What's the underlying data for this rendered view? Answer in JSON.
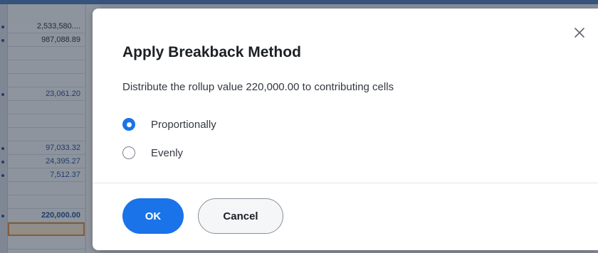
{
  "spreadsheet": {
    "values": [
      {
        "text": "2,533,580....",
        "style": ""
      },
      {
        "text": "987,088.89",
        "style": ""
      },
      {
        "text": "",
        "style": ""
      },
      {
        "text": "",
        "style": ""
      },
      {
        "text": "",
        "style": ""
      },
      {
        "text": "23,061.20",
        "style": "blue"
      },
      {
        "text": "",
        "style": ""
      },
      {
        "text": "",
        "style": ""
      },
      {
        "text": "",
        "style": ""
      },
      {
        "text": "97,033.32",
        "style": "blue"
      },
      {
        "text": "24,395.27",
        "style": "blue"
      },
      {
        "text": "7,512.37",
        "style": "blue"
      },
      {
        "text": "",
        "style": ""
      },
      {
        "text": "",
        "style": ""
      },
      {
        "text": "220,000.00",
        "style": "bold"
      },
      {
        "text": "",
        "style": "selected"
      },
      {
        "text": "",
        "style": ""
      }
    ]
  },
  "dialog": {
    "title": "Apply Breakback Method",
    "description": "Distribute the rollup value 220,000.00 to contributing cells",
    "options": [
      {
        "label": "Proportionally",
        "checked": true
      },
      {
        "label": "Evenly",
        "checked": false
      }
    ],
    "ok_label": "OK",
    "cancel_label": "Cancel",
    "close_icon": "close-icon"
  },
  "colors": {
    "primary": "#1a73e8",
    "overlay": "rgba(30,38,50,0.45)"
  }
}
